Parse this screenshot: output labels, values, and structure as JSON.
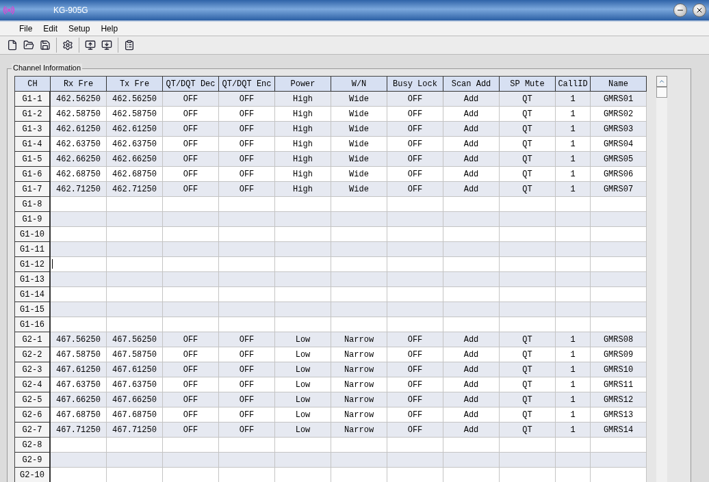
{
  "window": {
    "title": "KG-905G"
  },
  "menu": [
    "File",
    "Edit",
    "Setup",
    "Help"
  ],
  "toolbar": [
    {
      "kind": "new"
    },
    {
      "kind": "open"
    },
    {
      "kind": "save"
    },
    {
      "kind": "gear"
    },
    {
      "kind": "write"
    },
    {
      "kind": "read"
    },
    {
      "kind": "clipboard"
    }
  ],
  "group": {
    "title": "Channel Information"
  },
  "table": {
    "columns": [
      "CH",
      "Rx Fre",
      "Tx Fre",
      "QT/DQT Dec",
      "QT/DQT Enc",
      "Power",
      "W/N",
      "Busy Lock",
      "Scan Add",
      "SP Mute",
      "CallID",
      "Name"
    ],
    "rows": [
      {
        "ch": "G1-1",
        "editing": false,
        "cells": [
          "462.56250",
          "462.56250",
          "OFF",
          "OFF",
          "High",
          "Wide",
          "OFF",
          "Add",
          "QT",
          "1",
          "GMRS01"
        ]
      },
      {
        "ch": "G1-2",
        "editing": false,
        "cells": [
          "462.58750",
          "462.58750",
          "OFF",
          "OFF",
          "High",
          "Wide",
          "OFF",
          "Add",
          "QT",
          "1",
          "GMRS02"
        ]
      },
      {
        "ch": "G1-3",
        "editing": false,
        "cells": [
          "462.61250",
          "462.61250",
          "OFF",
          "OFF",
          "High",
          "Wide",
          "OFF",
          "Add",
          "QT",
          "1",
          "GMRS03"
        ]
      },
      {
        "ch": "G1-4",
        "editing": false,
        "cells": [
          "462.63750",
          "462.63750",
          "OFF",
          "OFF",
          "High",
          "Wide",
          "OFF",
          "Add",
          "QT",
          "1",
          "GMRS04"
        ]
      },
      {
        "ch": "G1-5",
        "editing": false,
        "cells": [
          "462.66250",
          "462.66250",
          "OFF",
          "OFF",
          "High",
          "Wide",
          "OFF",
          "Add",
          "QT",
          "1",
          "GMRS05"
        ]
      },
      {
        "ch": "G1-6",
        "editing": false,
        "cells": [
          "462.68750",
          "462.68750",
          "OFF",
          "OFF",
          "High",
          "Wide",
          "OFF",
          "Add",
          "QT",
          "1",
          "GMRS06"
        ]
      },
      {
        "ch": "G1-7",
        "editing": false,
        "cells": [
          "462.71250",
          "462.71250",
          "OFF",
          "OFF",
          "High",
          "Wide",
          "OFF",
          "Add",
          "QT",
          "1",
          "GMRS07"
        ]
      },
      {
        "ch": "G1-8",
        "editing": false
      },
      {
        "ch": "G1-9",
        "editing": false
      },
      {
        "ch": "G1-10",
        "editing": false
      },
      {
        "ch": "G1-11",
        "editing": false
      },
      {
        "ch": "G1-12",
        "editing": true
      },
      {
        "ch": "G1-13",
        "editing": false
      },
      {
        "ch": "G1-14",
        "editing": false
      },
      {
        "ch": "G1-15",
        "editing": false
      },
      {
        "ch": "G1-16",
        "editing": false
      },
      {
        "ch": "G2-1",
        "editing": false,
        "cells": [
          "467.56250",
          "467.56250",
          "OFF",
          "OFF",
          "Low",
          "Narrow",
          "OFF",
          "Add",
          "QT",
          "1",
          "GMRS08"
        ]
      },
      {
        "ch": "G2-2",
        "editing": false,
        "cells": [
          "467.58750",
          "467.58750",
          "OFF",
          "OFF",
          "Low",
          "Narrow",
          "OFF",
          "Add",
          "QT",
          "1",
          "GMRS09"
        ]
      },
      {
        "ch": "G2-3",
        "editing": false,
        "cells": [
          "467.61250",
          "467.61250",
          "OFF",
          "OFF",
          "Low",
          "Narrow",
          "OFF",
          "Add",
          "QT",
          "1",
          "GMRS10"
        ]
      },
      {
        "ch": "G2-4",
        "editing": false,
        "cells": [
          "467.63750",
          "467.63750",
          "OFF",
          "OFF",
          "Low",
          "Narrow",
          "OFF",
          "Add",
          "QT",
          "1",
          "GMRS11"
        ]
      },
      {
        "ch": "G2-5",
        "editing": false,
        "cells": [
          "467.66250",
          "467.66250",
          "OFF",
          "OFF",
          "Low",
          "Narrow",
          "OFF",
          "Add",
          "QT",
          "1",
          "GMRS12"
        ]
      },
      {
        "ch": "G2-6",
        "editing": false,
        "cells": [
          "467.68750",
          "467.68750",
          "OFF",
          "OFF",
          "Low",
          "Narrow",
          "OFF",
          "Add",
          "QT",
          "1",
          "GMRS13"
        ]
      },
      {
        "ch": "G2-7",
        "editing": false,
        "cells": [
          "467.71250",
          "467.71250",
          "OFF",
          "OFF",
          "Low",
          "Narrow",
          "OFF",
          "Add",
          "QT",
          "1",
          "GMRS14"
        ]
      },
      {
        "ch": "G2-8",
        "editing": false
      },
      {
        "ch": "G2-9",
        "editing": false
      },
      {
        "ch": "G2-10",
        "editing": false
      }
    ]
  }
}
